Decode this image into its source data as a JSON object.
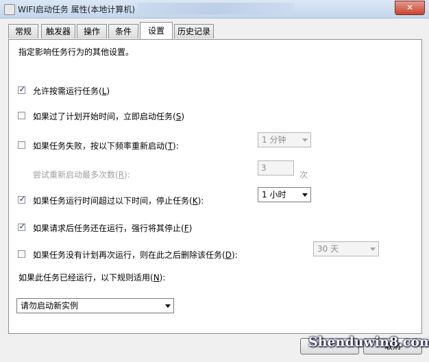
{
  "window": {
    "title": "WIFI启动任务 属性(本地计算机)",
    "close_glyph": "✕"
  },
  "tabs": [
    "常规",
    "触发器",
    "操作",
    "条件",
    "设置",
    "历史记录"
  ],
  "active_tab": "设置",
  "intro": "指定影响任务行为的其他设置。",
  "settings": {
    "allow_on_demand": {
      "checked": true,
      "label": "允许按需运行任务(",
      "key": "L",
      "suffix": ")"
    },
    "run_if_missed": {
      "checked": false,
      "label": "如果过了计划开始时间，立即启动任务(",
      "key": "S",
      "suffix": ")"
    },
    "restart_on_fail": {
      "checked": false,
      "label": "如果任务失败，按以下频率重新启动(",
      "key": "T",
      "suffix": "):",
      "interval": "1 分钟"
    },
    "restart_attempts": {
      "label": "尝试重新启动最多次数(",
      "key": "R",
      "suffix": "):",
      "value": "3",
      "unit": "次"
    },
    "stop_if_long": {
      "checked": true,
      "label": "如果任务运行时间超过以下时间，停止任务(",
      "key": "K",
      "suffix": "):",
      "duration": "1 小时"
    },
    "force_stop": {
      "checked": true,
      "label": "如果请求后任务还在运行，强行将其停止(",
      "key": "F",
      "suffix": ")"
    },
    "delete_if_not_scheduled": {
      "checked": false,
      "label": "如果任务没有计划再次运行，则在此之后删除该任务(",
      "key": "D",
      "suffix": "):",
      "delay": "30 天"
    },
    "already_running": {
      "label": "如果此任务已经运行，以下规则适用(",
      "key": "N",
      "suffix": "):",
      "rule": "请勿启动新实例"
    }
  },
  "buttons": {
    "ok": "",
    "cancel": "取消"
  },
  "watermark": "Shenduwin8.com"
}
